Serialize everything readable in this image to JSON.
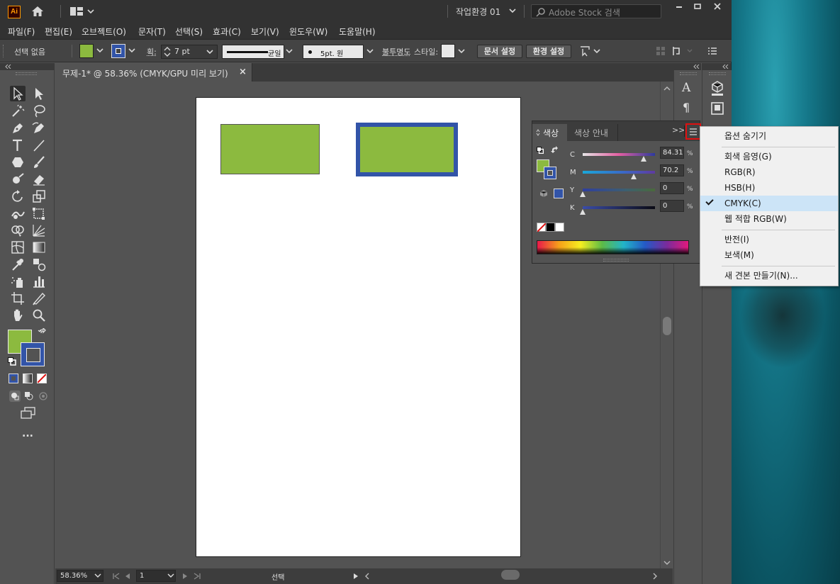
{
  "app": {
    "logo_text": "Ai",
    "workspace_label": "작업환경 01",
    "search_placeholder": "Adobe Stock 검색"
  },
  "menubar": [
    "파일(F)",
    "편집(E)",
    "오브젝트(O)",
    "문자(T)",
    "선택(S)",
    "효과(C)",
    "보기(V)",
    "윈도우(W)",
    "도움말(H)"
  ],
  "control_bar": {
    "selection_status": "선택 없음",
    "stroke_label": "획:",
    "stroke_weight": "7 pt",
    "stroke_profile": "균일",
    "brush": "5pt. 원",
    "opacity_label": "불투명도",
    "style_label": "스타일:",
    "document_setup_button": "문서 설정",
    "preferences_button": "환경 설정"
  },
  "document_tab": {
    "title": "무제-1* @ 58.36% (CMYK/GPU 미리 보기)",
    "close": "×"
  },
  "colors": {
    "fill": "#8cba3f",
    "stroke": "#3254a8",
    "accent_red": "#e01010"
  },
  "color_panel": {
    "tabs": [
      "색상",
      "색상 안내"
    ],
    "expand": ">>",
    "sliders": [
      {
        "label": "C",
        "value": "84.31",
        "fraction": 0.8431,
        "unit": "%"
      },
      {
        "label": "M",
        "value": "70.2",
        "fraction": 0.702,
        "unit": "%"
      },
      {
        "label": "Y",
        "value": "0",
        "fraction": 0,
        "unit": "%"
      },
      {
        "label": "K",
        "value": "0",
        "fraction": 0,
        "unit": "%"
      }
    ]
  },
  "panel_menu": {
    "items": [
      {
        "label": "옵션 숨기기",
        "checked": false
      },
      {
        "label": "회색 음영(G)",
        "checked": false
      },
      {
        "label": "RGB(R)",
        "checked": false
      },
      {
        "label": "HSB(H)",
        "checked": false
      },
      {
        "label": "CMYK(C)",
        "checked": true
      },
      {
        "label": "웹 적합 RGB(W)",
        "checked": false
      },
      {
        "label": "반전(I)",
        "checked": false
      },
      {
        "label": "보색(M)",
        "checked": false
      },
      {
        "label": "새 견본 만들기(N)...",
        "checked": false
      }
    ]
  },
  "status_bar": {
    "zoom": "58.36%",
    "page": "1",
    "status": "선택"
  },
  "toolbar": {
    "more": "..."
  },
  "right_dock": {
    "char_glyph": "A",
    "para_glyph": "¶"
  }
}
